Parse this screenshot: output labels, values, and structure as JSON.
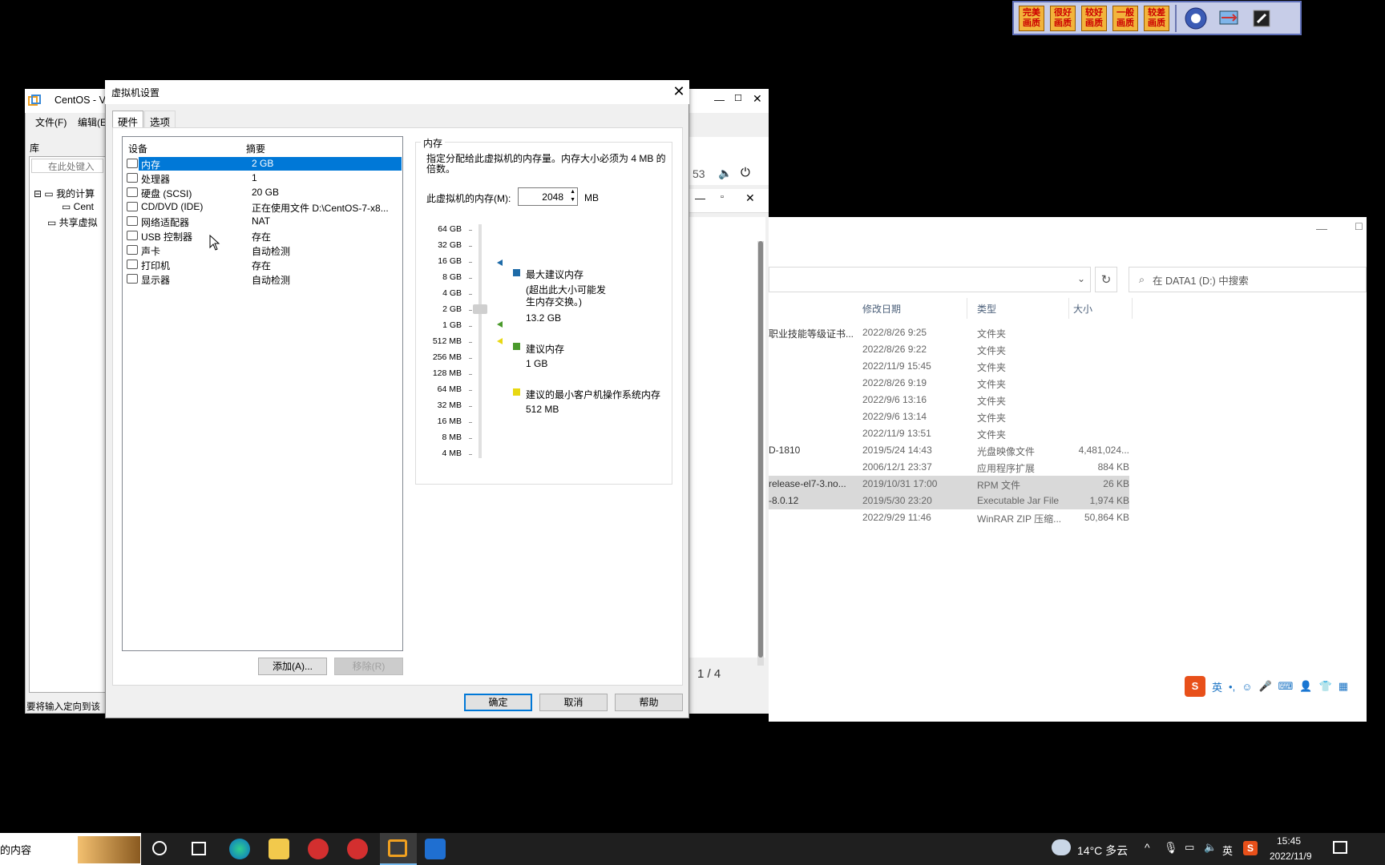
{
  "quality_bar": {
    "buttons": [
      "完美画质",
      "很好画质",
      "较好画质",
      "一般画质",
      "较差画质"
    ]
  },
  "vmware": {
    "title": "CentOS - V",
    "menu": [
      "文件(F)",
      "编辑(E"
    ],
    "library_label": "库",
    "search_placeholder": "在此处键入",
    "tree": [
      "我的计算",
      "Cent",
      "共享虚拟"
    ],
    "status": "要将输入定向到该",
    "time_partial": "53",
    "page_indicator": "1 / 4"
  },
  "explorer": {
    "search_placeholder": "在 DATA1 (D:) 中搜索",
    "columns": [
      "修改日期",
      "类型",
      "大小"
    ],
    "files": [
      {
        "name": "职业技能等级证书...",
        "date": "2022/8/26 9:25",
        "type": "文件夹",
        "size": ""
      },
      {
        "name": "",
        "date": "2022/8/26 9:22",
        "type": "文件夹",
        "size": ""
      },
      {
        "name": "",
        "date": "2022/11/9 15:45",
        "type": "文件夹",
        "size": ""
      },
      {
        "name": "",
        "date": "2022/8/26 9:19",
        "type": "文件夹",
        "size": ""
      },
      {
        "name": "",
        "date": "2022/9/6 13:16",
        "type": "文件夹",
        "size": ""
      },
      {
        "name": "",
        "date": "2022/9/6 13:14",
        "type": "文件夹",
        "size": ""
      },
      {
        "name": "",
        "date": "2022/11/9 13:51",
        "type": "文件夹",
        "size": ""
      },
      {
        "name": "D-1810",
        "date": "2019/5/24 14:43",
        "type": "光盘映像文件",
        "size": "4,481,024..."
      },
      {
        "name": "",
        "date": "2006/12/1 23:37",
        "type": "应用程序扩展",
        "size": "884 KB"
      },
      {
        "name": "release-el7-3.no...",
        "date": "2019/10/31 17:00",
        "type": "RPM 文件",
        "size": "26 KB"
      },
      {
        "name": "-8.0.12",
        "date": "2019/5/30 23:20",
        "type": "Executable Jar File",
        "size": "1,974 KB"
      },
      {
        "name": "",
        "date": "2022/9/29 11:46",
        "type": "WinRAR ZIP 压缩...",
        "size": "50,864 KB"
      }
    ]
  },
  "dialog": {
    "title": "虚拟机设置",
    "tabs": [
      "硬件",
      "选项"
    ],
    "list_headers": {
      "device": "设备",
      "summary": "摘要"
    },
    "devices": [
      {
        "name": "内存",
        "summary": "2 GB",
        "icon": "memory-icon"
      },
      {
        "name": "处理器",
        "summary": "1",
        "icon": "cpu-icon"
      },
      {
        "name": "硬盘 (SCSI)",
        "summary": "20 GB",
        "icon": "disk-icon"
      },
      {
        "name": "CD/DVD (IDE)",
        "summary": "正在使用文件 D:\\CentOS-7-x8...",
        "icon": "cd-icon"
      },
      {
        "name": "网络适配器",
        "summary": "NAT",
        "icon": "network-icon"
      },
      {
        "name": "USB 控制器",
        "summary": "存在",
        "icon": "usb-icon"
      },
      {
        "name": "声卡",
        "summary": "自动检测",
        "icon": "sound-icon"
      },
      {
        "name": "打印机",
        "summary": "存在",
        "icon": "printer-icon"
      },
      {
        "name": "显示器",
        "summary": "自动检测",
        "icon": "display-icon"
      }
    ],
    "add_button": "添加(A)...",
    "remove_button": "移除(R)",
    "ok_button": "确定",
    "cancel_button": "取消",
    "help_button": "帮助",
    "memory": {
      "group_label": "内存",
      "description": "指定分配给此虚拟机的内存量。内存大小必须为 4 MB 的倍数。",
      "field_label": "此虚拟机的内存(M):",
      "value": "2048",
      "unit": "MB",
      "scale": [
        "64 GB",
        "32 GB",
        "16 GB",
        "8 GB",
        "4 GB",
        "2 GB",
        "1 GB",
        "512 MB",
        "256 MB",
        "128 MB",
        "64 MB",
        "32 MB",
        "16 MB",
        "8 MB",
        "4 MB"
      ],
      "max_label": "最大建议内存",
      "max_note": "(超出此大小可能发生内存交换。)",
      "max_value": "13.2 GB",
      "rec_label": "建议内存",
      "rec_value": "1 GB",
      "min_label": "建议的最小客户机操作系统内存",
      "min_value": "512 MB",
      "colors": {
        "max": "#1e6ba8",
        "rec": "#4a9a2c",
        "min": "#e8d812"
      }
    }
  },
  "taskbar": {
    "search_text": "的内容",
    "weather": "14°C 多云",
    "ime": "英",
    "time": "15:45",
    "date": "2022/11/9"
  },
  "ime_bar": {
    "lang": "英"
  }
}
